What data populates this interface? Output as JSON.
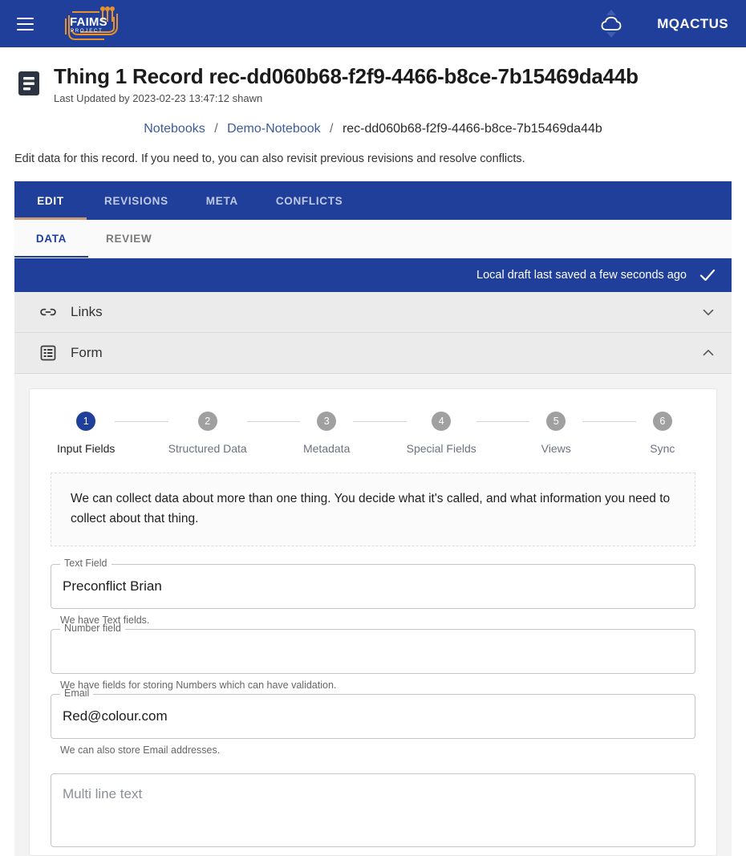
{
  "appbar": {
    "menu_label": "menu",
    "logo_text": "FAIMS",
    "logo_subtext": "PROJECT",
    "sync_icon": "cloud-icon",
    "username": "MQACTUS"
  },
  "record": {
    "title": "Thing 1 Record rec-dd060b68-f2f9-4466-b8ce-7b15469da44b",
    "subtitle": "Last Updated by 2023-02-23 13:47:12 shawn",
    "icon": "record-document-icon"
  },
  "breadcrumb": {
    "items": [
      {
        "label": "Notebooks",
        "link": true
      },
      {
        "label": "Demo-Notebook",
        "link": true
      },
      {
        "label": "rec-dd060b68-f2f9-4466-b8ce-7b15469da44b",
        "link": false
      }
    ],
    "separator": "/"
  },
  "intro": "Edit data for this record. If you need to, you can also revisit previous revisions and resolve conflicts.",
  "tabs": {
    "primary": [
      {
        "label": "EDIT",
        "active": true
      },
      {
        "label": "REVISIONS",
        "active": false
      },
      {
        "label": "META",
        "active": false
      },
      {
        "label": "CONFLICTS",
        "active": false
      }
    ],
    "secondary": [
      {
        "label": "DATA",
        "active": true
      },
      {
        "label": "REVIEW",
        "active": false
      }
    ]
  },
  "draft": {
    "status_text": "Local draft last saved a few seconds ago",
    "status_icon": "check-icon"
  },
  "accordions": [
    {
      "label": "Links",
      "icon": "link-chain-icon",
      "expanded": false,
      "chevron": "chevron-down-icon"
    },
    {
      "label": "Form",
      "icon": "form-list-icon",
      "expanded": true,
      "chevron": "chevron-up-icon"
    }
  ],
  "stepper": {
    "steps": [
      {
        "number": "1",
        "label": "Input Fields",
        "active": true
      },
      {
        "number": "2",
        "label": "Structured Data",
        "active": false
      },
      {
        "number": "3",
        "label": "Metadata",
        "active": false
      },
      {
        "number": "4",
        "label": "Special Fields",
        "active": false
      },
      {
        "number": "5",
        "label": "Views",
        "active": false
      },
      {
        "number": "6",
        "label": "Sync",
        "active": false
      }
    ]
  },
  "info_box": {
    "text": "We can collect data about more than one thing. You decide what it's called, and what information you need to collect about that thing."
  },
  "fields": [
    {
      "name": "text-field",
      "label": "Text Field",
      "value": "Preconflict Brian",
      "placeholder": "",
      "helper": "We have Text fields."
    },
    {
      "name": "number-field",
      "label": "Number field",
      "value": "",
      "placeholder": "",
      "helper": "We have fields for storing Numbers which can have validation."
    },
    {
      "name": "email-field",
      "label": "Email",
      "value": "Red@colour.com",
      "placeholder": "",
      "helper": "We can also store Email addresses."
    },
    {
      "name": "multiline-text-field",
      "label": "",
      "value": "",
      "placeholder": "Multi line text",
      "helper": ""
    }
  ],
  "colors": {
    "primary_blue": "#1f3f9b",
    "accent_orange": "#c79a79",
    "logo_orange": "#e8902a",
    "panel_grey": "#ebebeb",
    "step_inactive": "#a0a0a0"
  }
}
